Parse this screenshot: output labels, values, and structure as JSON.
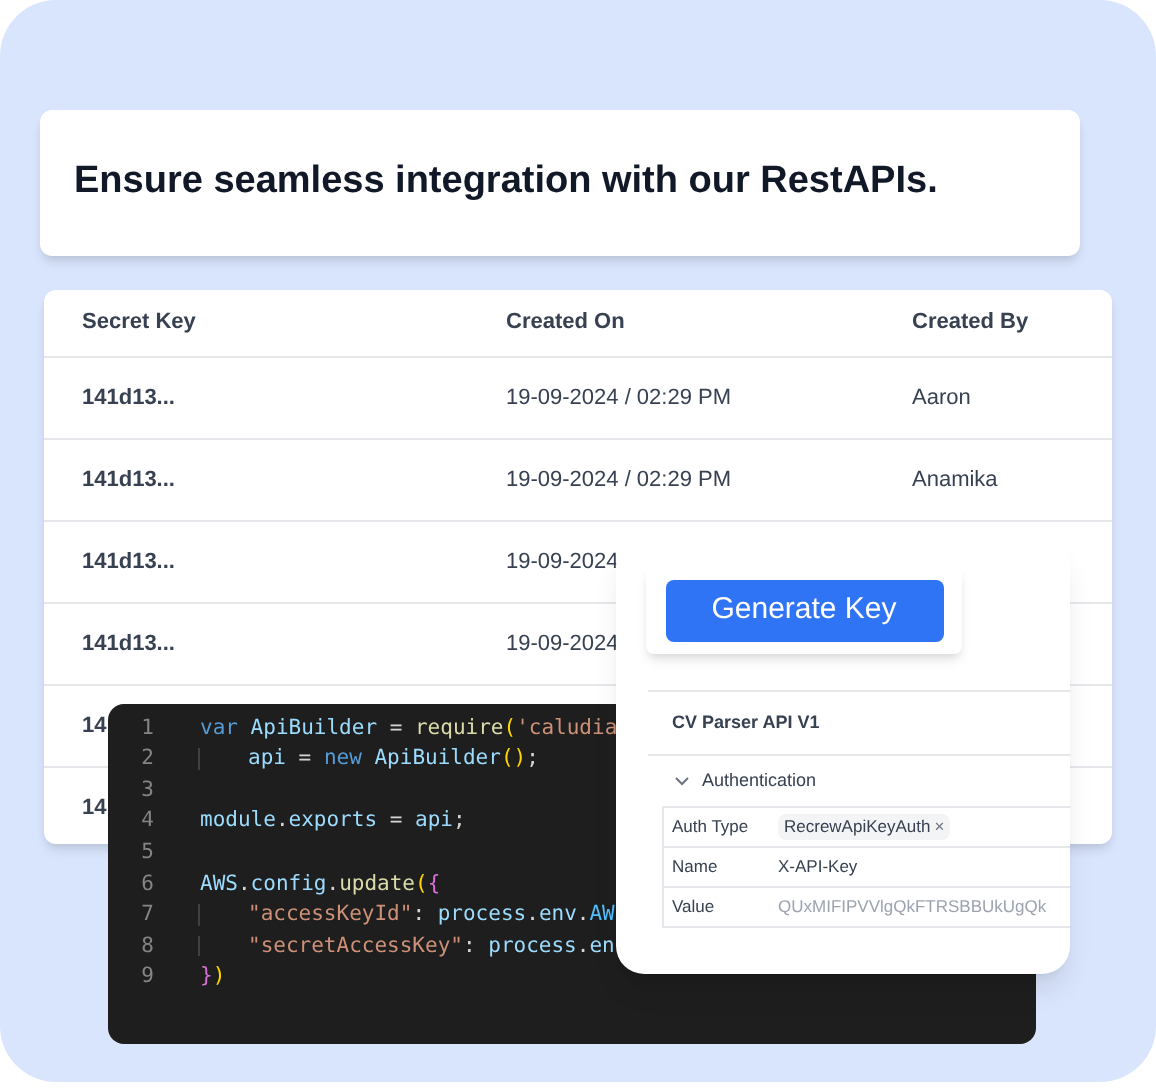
{
  "headline": "Ensure seamless integration with our RestAPIs.",
  "table": {
    "columns": [
      "Secret Key",
      "Created On",
      "Created By"
    ],
    "rows": [
      {
        "cells": [
          "141d13...",
          "19-09-2024 / 02:29 PM",
          "Aaron"
        ]
      },
      {
        "cells": [
          "141d13...",
          "19-09-2024 / 02:29 PM",
          "Anamika"
        ]
      },
      {
        "cells": [
          "141d13...",
          "19-09-2024"
        ]
      },
      {
        "cells": [
          "141d13...",
          "19-09-2024"
        ]
      },
      {
        "cells": [
          "14"
        ]
      },
      {
        "cells": [
          "14"
        ]
      }
    ]
  },
  "code": {
    "lines": [
      {
        "number": "1",
        "indent": false,
        "tokens": [
          {
            "kind": "keyword",
            "text": "var "
          },
          {
            "kind": "ident",
            "text": "ApiBuilder"
          },
          {
            "kind": "plain",
            "text": " = "
          },
          {
            "kind": "func",
            "text": "require"
          },
          {
            "kind": "bracket",
            "text": "("
          },
          {
            "kind": "string",
            "text": "'caludia"
          }
        ]
      },
      {
        "number": "2",
        "indent": true,
        "tokens": [
          {
            "kind": "ident",
            "text": "api"
          },
          {
            "kind": "plain",
            "text": " = "
          },
          {
            "kind": "keyword",
            "text": "new "
          },
          {
            "kind": "ident",
            "text": "ApiBuilder"
          },
          {
            "kind": "bracket",
            "text": "()"
          },
          {
            "kind": "plain",
            "text": ";"
          }
        ]
      },
      {
        "number": "3"
      },
      {
        "number": "4",
        "indent": false,
        "tokens": [
          {
            "kind": "ident",
            "text": "module"
          },
          {
            "kind": "plain",
            "text": "."
          },
          {
            "kind": "ident",
            "text": "exports"
          },
          {
            "kind": "plain",
            "text": " = "
          },
          {
            "kind": "ident",
            "text": "api"
          },
          {
            "kind": "plain",
            "text": ";"
          }
        ]
      },
      {
        "number": "5"
      },
      {
        "number": "6",
        "indent": false,
        "tokens": [
          {
            "kind": "ident",
            "text": "AWS"
          },
          {
            "kind": "plain",
            "text": "."
          },
          {
            "kind": "ident",
            "text": "config"
          },
          {
            "kind": "plain",
            "text": "."
          },
          {
            "kind": "func",
            "text": "update"
          },
          {
            "kind": "bracket",
            "text": "("
          },
          {
            "kind": "brace",
            "text": "{"
          }
        ]
      },
      {
        "number": "7",
        "indent": true,
        "tokens": [
          {
            "kind": "string",
            "text": "\"accessKeyId\""
          },
          {
            "kind": "plain",
            "text": ": "
          },
          {
            "kind": "ident",
            "text": "process"
          },
          {
            "kind": "plain",
            "text": "."
          },
          {
            "kind": "ident",
            "text": "env"
          },
          {
            "kind": "plain",
            "text": "."
          },
          {
            "kind": "const",
            "text": "AW"
          }
        ]
      },
      {
        "number": "8",
        "indent": true,
        "tokens": [
          {
            "kind": "string",
            "text": "\"secretAccessKey\""
          },
          {
            "kind": "plain",
            "text": ": "
          },
          {
            "kind": "ident",
            "text": "process"
          },
          {
            "kind": "plain",
            "text": "."
          },
          {
            "kind": "ident",
            "text": "en"
          }
        ]
      },
      {
        "number": "9",
        "indent": false,
        "tokens": [
          {
            "kind": "brace",
            "text": "}"
          },
          {
            "kind": "bracket",
            "text": ")"
          }
        ]
      }
    ]
  },
  "api_card": {
    "button": "Generate Key",
    "api_name": "CV Parser API V1",
    "section": {
      "title": "Authentication",
      "expanded": true
    },
    "fields": [
      {
        "kind": "tag",
        "label": "Auth Type",
        "value": "RecrewApiKeyAuth",
        "remove": "×"
      },
      {
        "kind": "text",
        "label": "Name",
        "value": "X-API-Key"
      },
      {
        "kind": "secret",
        "label": "Value",
        "value": "QUxMIFIPVVlgQkFTRSBBUkUgQk"
      }
    ]
  }
}
